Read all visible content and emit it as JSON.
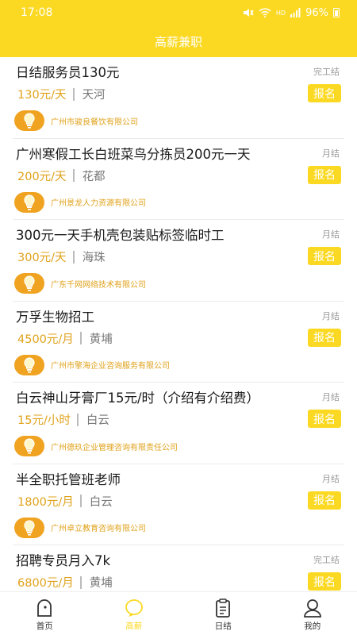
{
  "status": {
    "time": "17:08",
    "signal": "HD",
    "battery": "96%"
  },
  "header": {
    "title": "高薪兼职"
  },
  "jobs": [
    {
      "title": "日结服务员130元",
      "settle": "完工结",
      "pay": "130元/天",
      "area": "天河",
      "apply": "报名",
      "company": "广州市骏良餐饮有限公司"
    },
    {
      "title": "广州寒假工长白班菜鸟分拣员200元一天",
      "settle": "月结",
      "pay": "200元/天",
      "area": "花都",
      "apply": "报名",
      "company": "广州景龙人力资源有限公司"
    },
    {
      "title": "300元一天手机壳包装贴标签临时工",
      "settle": "月结",
      "pay": "300元/天",
      "area": "海珠",
      "apply": "报名",
      "company": "广东千网网络技术有限公司"
    },
    {
      "title": "万孚生物招工",
      "settle": "月结",
      "pay": "4500元/月",
      "area": "黄埔",
      "apply": "报名",
      "company": "广州市擎海企业咨询服务有限公司"
    },
    {
      "title": "白云神山牙膏厂15元/时（介绍有介绍费）",
      "settle": "月结",
      "pay": "15元/小时",
      "area": "白云",
      "apply": "报名",
      "company": "广州德玖企业管理咨询有限责任公司"
    },
    {
      "title": "半全职托管班老师",
      "settle": "月结",
      "pay": "1800元/月",
      "area": "白云",
      "apply": "报名",
      "company": "广州卓立教育咨询有限公司"
    },
    {
      "title": "招聘专员月入7k",
      "settle": "完工结",
      "pay": "6800元/月",
      "area": "黄埔",
      "apply": "报名",
      "company": ""
    }
  ],
  "tabs": [
    {
      "label": "首页",
      "icon": "home-icon"
    },
    {
      "label": "高薪",
      "icon": "high-pay-icon"
    },
    {
      "label": "日结",
      "icon": "clipboard-icon"
    },
    {
      "label": "我的",
      "icon": "profile-icon"
    }
  ],
  "colors": {
    "brand": "#fbd923",
    "pay": "#e0a21b",
    "bulb": "#f0a321"
  }
}
